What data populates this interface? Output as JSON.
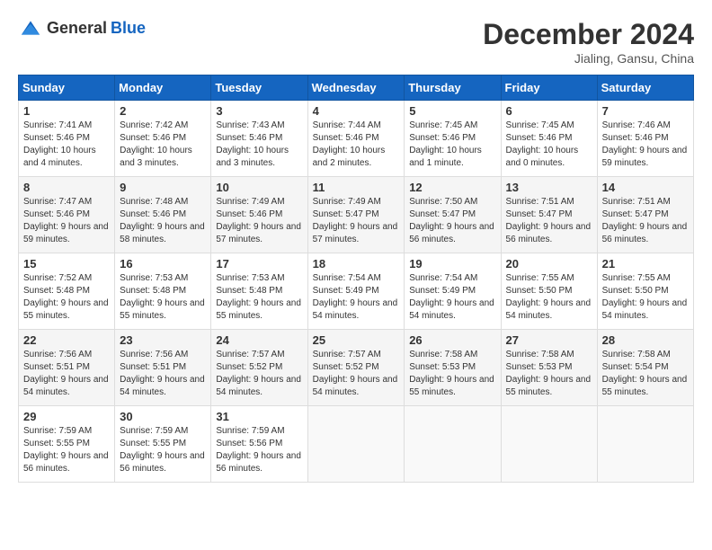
{
  "header": {
    "logo_general": "General",
    "logo_blue": "Blue",
    "month_title": "December 2024",
    "location": "Jialing, Gansu, China"
  },
  "days_of_week": [
    "Sunday",
    "Monday",
    "Tuesday",
    "Wednesday",
    "Thursday",
    "Friday",
    "Saturday"
  ],
  "weeks": [
    [
      {
        "day": "1",
        "sunrise": "7:41 AM",
        "sunset": "5:46 PM",
        "daylight": "10 hours and 4 minutes."
      },
      {
        "day": "2",
        "sunrise": "7:42 AM",
        "sunset": "5:46 PM",
        "daylight": "10 hours and 3 minutes."
      },
      {
        "day": "3",
        "sunrise": "7:43 AM",
        "sunset": "5:46 PM",
        "daylight": "10 hours and 3 minutes."
      },
      {
        "day": "4",
        "sunrise": "7:44 AM",
        "sunset": "5:46 PM",
        "daylight": "10 hours and 2 minutes."
      },
      {
        "day": "5",
        "sunrise": "7:45 AM",
        "sunset": "5:46 PM",
        "daylight": "10 hours and 1 minute."
      },
      {
        "day": "6",
        "sunrise": "7:45 AM",
        "sunset": "5:46 PM",
        "daylight": "10 hours and 0 minutes."
      },
      {
        "day": "7",
        "sunrise": "7:46 AM",
        "sunset": "5:46 PM",
        "daylight": "9 hours and 59 minutes."
      }
    ],
    [
      {
        "day": "8",
        "sunrise": "7:47 AM",
        "sunset": "5:46 PM",
        "daylight": "9 hours and 59 minutes."
      },
      {
        "day": "9",
        "sunrise": "7:48 AM",
        "sunset": "5:46 PM",
        "daylight": "9 hours and 58 minutes."
      },
      {
        "day": "10",
        "sunrise": "7:49 AM",
        "sunset": "5:46 PM",
        "daylight": "9 hours and 57 minutes."
      },
      {
        "day": "11",
        "sunrise": "7:49 AM",
        "sunset": "5:47 PM",
        "daylight": "9 hours and 57 minutes."
      },
      {
        "day": "12",
        "sunrise": "7:50 AM",
        "sunset": "5:47 PM",
        "daylight": "9 hours and 56 minutes."
      },
      {
        "day": "13",
        "sunrise": "7:51 AM",
        "sunset": "5:47 PM",
        "daylight": "9 hours and 56 minutes."
      },
      {
        "day": "14",
        "sunrise": "7:51 AM",
        "sunset": "5:47 PM",
        "daylight": "9 hours and 56 minutes."
      }
    ],
    [
      {
        "day": "15",
        "sunrise": "7:52 AM",
        "sunset": "5:48 PM",
        "daylight": "9 hours and 55 minutes."
      },
      {
        "day": "16",
        "sunrise": "7:53 AM",
        "sunset": "5:48 PM",
        "daylight": "9 hours and 55 minutes."
      },
      {
        "day": "17",
        "sunrise": "7:53 AM",
        "sunset": "5:48 PM",
        "daylight": "9 hours and 55 minutes."
      },
      {
        "day": "18",
        "sunrise": "7:54 AM",
        "sunset": "5:49 PM",
        "daylight": "9 hours and 54 minutes."
      },
      {
        "day": "19",
        "sunrise": "7:54 AM",
        "sunset": "5:49 PM",
        "daylight": "9 hours and 54 minutes."
      },
      {
        "day": "20",
        "sunrise": "7:55 AM",
        "sunset": "5:50 PM",
        "daylight": "9 hours and 54 minutes."
      },
      {
        "day": "21",
        "sunrise": "7:55 AM",
        "sunset": "5:50 PM",
        "daylight": "9 hours and 54 minutes."
      }
    ],
    [
      {
        "day": "22",
        "sunrise": "7:56 AM",
        "sunset": "5:51 PM",
        "daylight": "9 hours and 54 minutes."
      },
      {
        "day": "23",
        "sunrise": "7:56 AM",
        "sunset": "5:51 PM",
        "daylight": "9 hours and 54 minutes."
      },
      {
        "day": "24",
        "sunrise": "7:57 AM",
        "sunset": "5:52 PM",
        "daylight": "9 hours and 54 minutes."
      },
      {
        "day": "25",
        "sunrise": "7:57 AM",
        "sunset": "5:52 PM",
        "daylight": "9 hours and 54 minutes."
      },
      {
        "day": "26",
        "sunrise": "7:58 AM",
        "sunset": "5:53 PM",
        "daylight": "9 hours and 55 minutes."
      },
      {
        "day": "27",
        "sunrise": "7:58 AM",
        "sunset": "5:53 PM",
        "daylight": "9 hours and 55 minutes."
      },
      {
        "day": "28",
        "sunrise": "7:58 AM",
        "sunset": "5:54 PM",
        "daylight": "9 hours and 55 minutes."
      }
    ],
    [
      {
        "day": "29",
        "sunrise": "7:59 AM",
        "sunset": "5:55 PM",
        "daylight": "9 hours and 56 minutes."
      },
      {
        "day": "30",
        "sunrise": "7:59 AM",
        "sunset": "5:55 PM",
        "daylight": "9 hours and 56 minutes."
      },
      {
        "day": "31",
        "sunrise": "7:59 AM",
        "sunset": "5:56 PM",
        "daylight": "9 hours and 56 minutes."
      },
      null,
      null,
      null,
      null
    ]
  ],
  "labels": {
    "sunrise": "Sunrise:",
    "sunset": "Sunset:",
    "daylight": "Daylight:"
  }
}
